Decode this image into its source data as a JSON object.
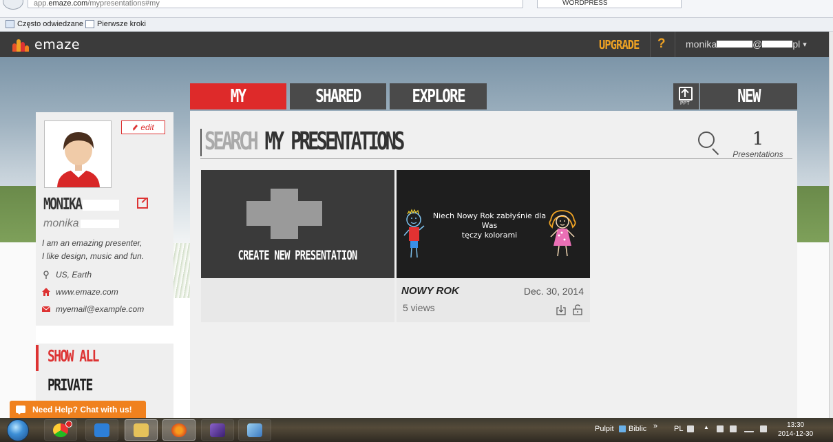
{
  "browser": {
    "url_prefix": "app.",
    "url_domain": "emaze.com",
    "url_path": "/mypresentations#my",
    "search_box_text": "WORDPRESS",
    "bookmarks": [
      "Często odwiedzane",
      "Pierwsze kroki"
    ]
  },
  "header": {
    "logo_text": "emaze",
    "upgrade_label": "UPGRADE",
    "help_label": "?",
    "user_prefix": "monika",
    "user_at": "@",
    "user_suffix": "pl",
    "user_caret": "▾"
  },
  "tabs": {
    "my": "MY",
    "shared": "SHARED",
    "explore": "EXPLORE",
    "ppt_label": "PPT",
    "new": "NEW"
  },
  "search": {
    "word1": "SEARCH",
    "word2": "MY PRESENTATIONS",
    "count": "1",
    "count_label": "Presentations"
  },
  "create_card": {
    "label": "CREATE NEW PRESENTATION"
  },
  "presentation": {
    "thumb_text_line1": "Niech Nowy Rok zabłyśnie dla Was",
    "thumb_text_line2": "tęczy kolorami",
    "title": "NOWY ROK",
    "date": "Dec. 30, 2014",
    "views": "5 views"
  },
  "profile": {
    "edit_label": "edit",
    "name": "MONIKA",
    "username": "monika",
    "bio_line1": "I am an emazing presenter,",
    "bio_line2": "I like design, music and fun.",
    "location": "US, Earth",
    "website": "www.emaze.com",
    "email": "myemail@example.com"
  },
  "filters": {
    "show_all": "SHOW ALL",
    "private": "PRIVATE"
  },
  "chat": {
    "label": "Need Help? Chat with us!"
  },
  "taskbar": {
    "pulpit": "Pulpit",
    "biblio": "Biblic",
    "chevron": "»",
    "lang": "PL",
    "time": "13:30",
    "date": "2014-12-30"
  },
  "colors": {
    "accent_red": "#de2a2a",
    "upgrade_orange": "#f0a323",
    "chat_orange": "#f0811e",
    "header_dark": "#3b3b3b"
  }
}
